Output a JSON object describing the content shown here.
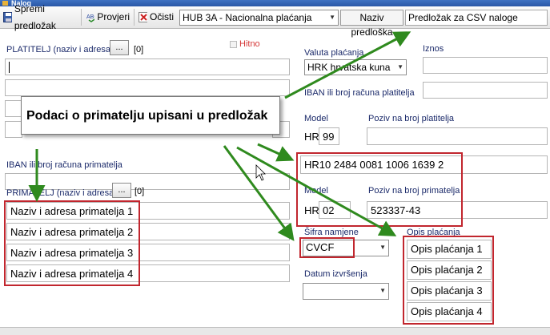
{
  "window": {
    "title": "Nalog"
  },
  "toolbar": {
    "save_label": "Spremi predložak",
    "check_label": "Provjeri",
    "clear_label": "Očisti",
    "template_type": "HUB 3A - Nacionalna plaćanja",
    "template_name_label": "Naziv predloška",
    "template_name_value": "Predložak za CSV naloge"
  },
  "payer": {
    "label": "PLATITELJ (naziv i adresa)",
    "dots": "...",
    "count": "[0]",
    "urgent_label": "Hitno"
  },
  "recipient": {
    "iban_label": "IBAN ili broj računa primatelja",
    "label": "PRIMATELJ (naziv i adresa)",
    "dots": "...",
    "count": "[0]",
    "lines": [
      "Naziv i adresa primatelja 1",
      "Naziv i adresa primatelja 2",
      "Naziv i adresa primatelja 3",
      "Naziv i adresa primatelja 4"
    ]
  },
  "payment": {
    "currency_label": "Valuta plaćanja",
    "currency_value": "HRK hrvatska kuna",
    "amount_label": "Iznos",
    "payer_iban_label": "IBAN ili broj računa platitelja",
    "model_label": "Model",
    "payer_ref_label": "Poziv na broj platitelja",
    "payer_model_prefix": "HR",
    "payer_model_value": "99",
    "recipient_iban_value": "HR10 2484 0081 1006 1639 2",
    "recipient_model_label": "Model",
    "recipient_ref_label": "Poziv na broj primatelja",
    "recipient_model_prefix": "HR",
    "recipient_model_value": "02",
    "recipient_ref_value": "523337-43",
    "purpose_code_label": "Šifra namjene",
    "purpose_code_value": "CVCF",
    "description_label": "Opis plaćanja",
    "description_lines": [
      "Opis plaćanja 1",
      "Opis plaćanja 2",
      "Opis plaćanja 3",
      "Opis plaćanja 4"
    ],
    "execution_date_label": "Datum izvršenja"
  },
  "callout": {
    "text": "Podaci o primatelju upisani u predložak"
  },
  "colors": {
    "highlight_red": "#c1262e",
    "arrow_green": "#2f8a1e",
    "label_blue": "#1b2a6a"
  }
}
